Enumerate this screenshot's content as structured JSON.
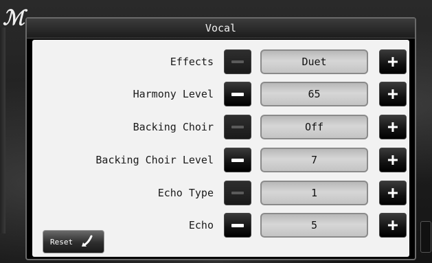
{
  "dialog": {
    "title": "Vocal",
    "rows": [
      {
        "label": "Effects",
        "value": "Duet",
        "minus_enabled": false
      },
      {
        "label": "Harmony Level",
        "value": "65",
        "minus_enabled": true
      },
      {
        "label": "Backing Choir",
        "value": "Off",
        "minus_enabled": false
      },
      {
        "label": "Backing Choir Level",
        "value": "7",
        "minus_enabled": true
      },
      {
        "label": "Echo Type",
        "value": "1",
        "minus_enabled": false
      },
      {
        "label": "Echo",
        "value": "5",
        "minus_enabled": true
      }
    ],
    "reset_label": "Reset"
  },
  "icons": {
    "minus": "minus-icon",
    "plus": "plus-icon",
    "reset": "return-arrow-icon"
  }
}
